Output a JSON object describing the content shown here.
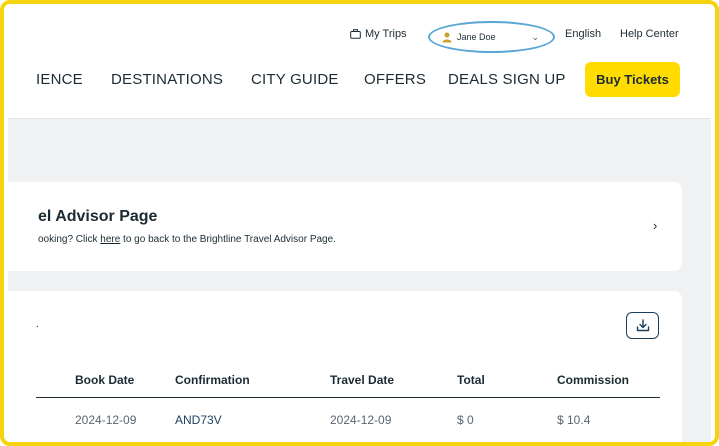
{
  "utility": {
    "my_trips": "My Trips",
    "user_name": "Jane Doe",
    "language": "English",
    "help_center": "Help Center"
  },
  "nav": {
    "experience": "IENCE",
    "destinations": "DESTINATIONS",
    "city_guide": "CITY GUIDE",
    "offers": "OFFERS",
    "deals_sign_up": "DEALS SIGN UP",
    "buy_tickets": "Buy Tickets"
  },
  "advisor": {
    "title": "el Advisor Page",
    "sub_prefix": "ooking? Click ",
    "sub_link": "here",
    "sub_suffix": " to go back to the Brightline Travel Advisor Page.",
    "chevron": "›"
  },
  "table": {
    "stub": ".",
    "headers": [
      "Book Date",
      "Confirmation",
      "Travel Date",
      "Total",
      "Commission"
    ],
    "rows": [
      [
        "2024-12-09",
        "AND73V",
        "2024-12-09",
        "$ 0",
        "$ 10.4"
      ]
    ]
  },
  "colors": {
    "accent": "#ffdb00",
    "frame": "#f5d40f",
    "highlight_ring": "#5aa6d6",
    "background": "#f0f1f3",
    "text": "#1c2b33"
  },
  "icons": {
    "trips": "briefcase-icon",
    "user": "user-icon",
    "chevron": "chevron-down-icon",
    "download": "download-icon"
  }
}
